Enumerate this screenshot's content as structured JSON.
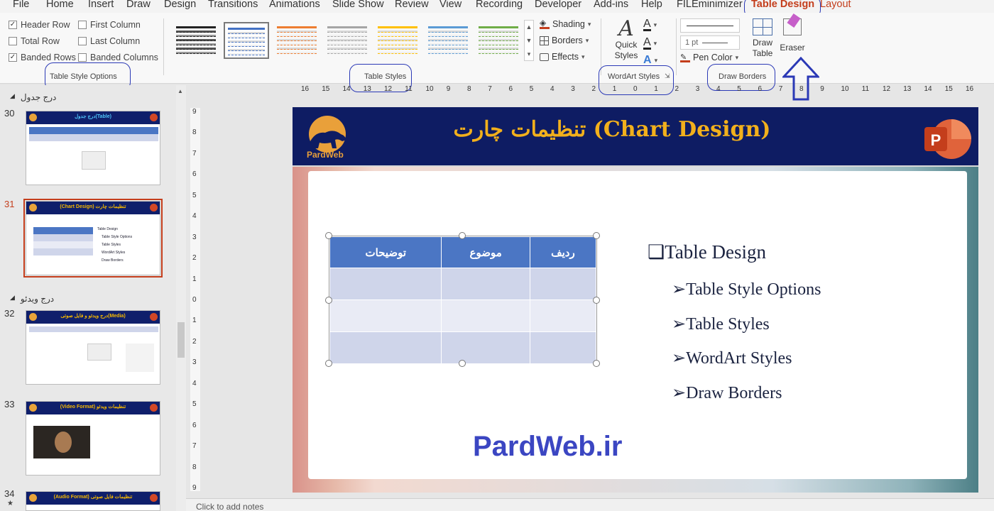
{
  "menu": {
    "tabs": [
      "File",
      "Home",
      "Insert",
      "Draw",
      "Design",
      "Transitions",
      "Animations",
      "Slide Show",
      "Review",
      "View",
      "Recording",
      "Developer",
      "Add-ins",
      "Help",
      "FILEminimizer",
      "Table Design",
      "Layout"
    ],
    "active_tab": "Table Design"
  },
  "ribbon": {
    "table_style_options": {
      "label": "Table Style Options",
      "options": [
        {
          "label": "Header Row",
          "checked": true
        },
        {
          "label": "First Column",
          "checked": false
        },
        {
          "label": "Total Row",
          "checked": false
        },
        {
          "label": "Last Column",
          "checked": false
        },
        {
          "label": "Banded Rows",
          "checked": true
        },
        {
          "label": "Banded Columns",
          "checked": false
        }
      ]
    },
    "table_styles": {
      "label": "Table Styles",
      "accent_colors": [
        "#222222",
        "#4472c4",
        "#ed7d31",
        "#a5a5a5",
        "#ffc000",
        "#5b9bd5",
        "#70ad47"
      ],
      "shading": "Shading",
      "borders": "Borders",
      "effects": "Effects"
    },
    "wordart_styles": {
      "label": "WordArt Styles",
      "quick_styles": "Quick Styles"
    },
    "draw_borders": {
      "label": "Draw Borders",
      "pen_weight": "1 pt",
      "pen_color": "Pen Color",
      "draw_table": "Draw Table",
      "eraser": "Eraser"
    }
  },
  "ruler": {
    "ticks": [
      "16",
      "15",
      "14",
      "13",
      "12",
      "11",
      "10",
      "9",
      "8",
      "7",
      "6",
      "5",
      "4",
      "3",
      "2",
      "1",
      "0",
      "1",
      "2",
      "3",
      "4",
      "5",
      "6",
      "7",
      "8",
      "9",
      "10",
      "11",
      "12",
      "13",
      "14",
      "15",
      "16"
    ],
    "vticks": [
      "9",
      "8",
      "7",
      "6",
      "5",
      "4",
      "3",
      "2",
      "1",
      "0",
      "1",
      "2",
      "3",
      "4",
      "5",
      "6",
      "7",
      "8",
      "9"
    ]
  },
  "slides_panel": {
    "sections": [
      "درج جدول",
      "درج ویدئو"
    ],
    "slides": [
      {
        "number": "30",
        "title": "درج جدول(Table)",
        "selected": false
      },
      {
        "number": "31",
        "title": "(Chart Design) تنظیمات چارت",
        "selected": true
      },
      {
        "number": "32",
        "title": "درج ویدئو و فایل صوتی(Media)",
        "selected": false
      },
      {
        "number": "33",
        "title": "(Video Format) تنظیمات ویدئو",
        "selected": false
      },
      {
        "number": "34",
        "title": "(Audio Format) تنظیمات فایل صوتی",
        "selected": false
      }
    ]
  },
  "slide": {
    "title": "تنظیمات چارت (Chart Design)",
    "logo_text": "PardWeb",
    "table_headers": [
      "توضیحات",
      "موضوع",
      "ردیف"
    ],
    "bullets": {
      "main": "Table Design",
      "items": [
        "Table Style Options",
        "Table Styles",
        "WordArt Styles",
        "Draw Borders"
      ]
    },
    "watermark": "PardWeb.ir"
  },
  "notes": {
    "placeholder": "Click to add notes"
  },
  "colors": {
    "accent": "#c43e1c",
    "slide_header": "#0e1c63",
    "title_gold": "#f2b01c",
    "table_header": "#4b76c4",
    "annotation": "#2b39b6"
  }
}
